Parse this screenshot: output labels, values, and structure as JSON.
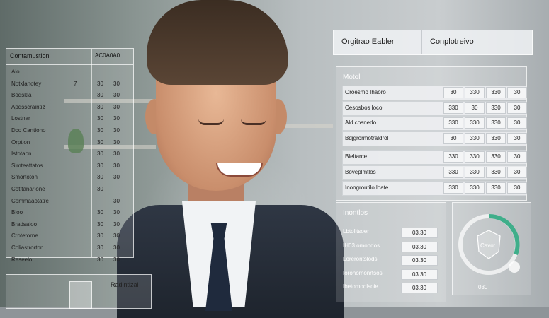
{
  "left_panel": {
    "header_title": "Contamustion",
    "header_right": "AC0A0A0",
    "rows": [
      {
        "label": "Alo",
        "num": "",
        "a": "",
        "b": ""
      },
      {
        "label": "Notklanotey",
        "num": "7",
        "a": "30",
        "b": "30"
      },
      {
        "label": "Bodskla",
        "num": "",
        "a": "30",
        "b": "30"
      },
      {
        "label": "Apdsscraintiz",
        "num": "",
        "a": "30",
        "b": "30"
      },
      {
        "label": "Lostnar",
        "num": "",
        "a": "30",
        "b": "30"
      },
      {
        "label": "Dco Cantiono",
        "num": "",
        "a": "30",
        "b": "30"
      },
      {
        "label": "Orption",
        "num": "",
        "a": "30",
        "b": "30"
      },
      {
        "label": "Istotaon",
        "num": "",
        "a": "30",
        "b": "30"
      },
      {
        "label": "Simteaftatos",
        "num": "",
        "a": "30",
        "b": "30"
      },
      {
        "label": "Smortoton",
        "num": "",
        "a": "30",
        "b": "30"
      },
      {
        "label": "Cotltanarione",
        "num": "",
        "a": "30",
        "b": ""
      },
      {
        "label": "Commaaotatre",
        "num": "",
        "a": "",
        "b": "30"
      },
      {
        "label": "Bloo",
        "num": "",
        "a": "30",
        "b": "30"
      },
      {
        "label": "Bradsaloo",
        "num": "",
        "a": "30",
        "b": "30"
      },
      {
        "label": "Crotetorne",
        "num": "",
        "a": "30",
        "b": "30"
      },
      {
        "label": "Coliastrorton",
        "num": "",
        "a": "30",
        "b": "30"
      },
      {
        "label": "Reseelo",
        "num": "",
        "a": "30",
        "b": "30"
      }
    ]
  },
  "top_bar": {
    "left": "Orgitrao Eabler",
    "right": "Conplotreivo"
  },
  "metric_panel": {
    "title": "Motol",
    "rows": [
      {
        "label": "Oroesmo Ihaoro",
        "v": [
          "30",
          "330",
          "330",
          "30"
        ]
      },
      {
        "label": "Cesosbos loco",
        "v": [
          "330",
          "30",
          "330",
          "30"
        ]
      },
      {
        "label": "Ald cosnedo",
        "v": [
          "330",
          "330",
          "330",
          "30"
        ]
      },
      {
        "label": "Bdjgrormotraldrol",
        "v": [
          "30",
          "330",
          "330",
          "30"
        ]
      },
      {
        "label": "Bleltarce",
        "v": [
          "330",
          "330",
          "330",
          "30"
        ]
      },
      {
        "label": "Boveplmtlos",
        "v": [
          "330",
          "330",
          "330",
          "30"
        ]
      },
      {
        "label": "Inongroutilo loate",
        "v": [
          "330",
          "330",
          "330",
          "30"
        ]
      }
    ]
  },
  "bottom_panel": {
    "title": "Inontlos",
    "rows": [
      {
        "label": "Lbtolltsoer",
        "value": "03.30"
      },
      {
        "label": "IH03 omondos",
        "value": "03.30"
      },
      {
        "label": "Lorerontslods",
        "value": "03.30"
      },
      {
        "label": "Ioronomonrtsos",
        "value": "03.30"
      },
      {
        "label": "Ibetomoolsoie",
        "value": "03.30"
      }
    ]
  },
  "gauge_panel": {
    "center": "Cavot",
    "footer": "030"
  },
  "bottom_left_panel": {
    "title": "Radintizal"
  }
}
